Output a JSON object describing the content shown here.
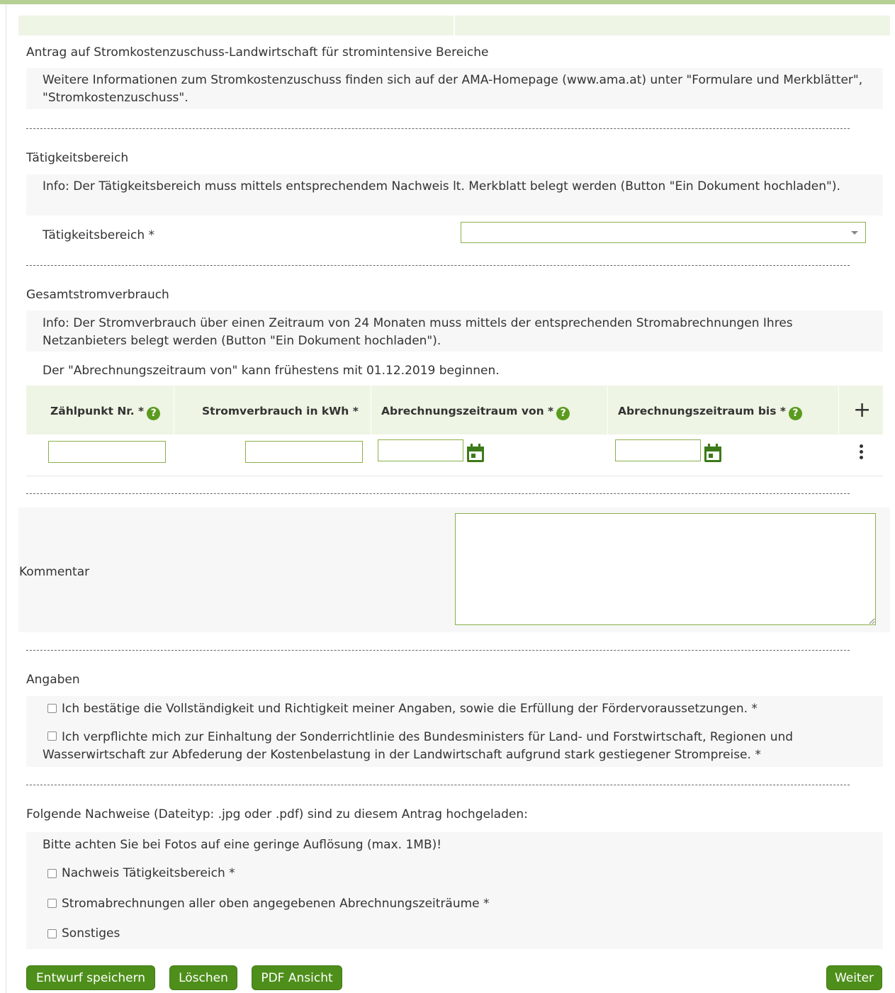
{
  "form_title": "Antrag auf Stromkostenzuschuss-Landwirtschaft für stromintensive Bereiche",
  "intro_info": "Weitere Informationen zum Stromkostenzuschuss finden sich auf der AMA-Homepage (www.ama.at) unter \"Formulare und Merkblätter\", \"Stromkostenzuschuss\".",
  "taetigkeit": {
    "heading": "Tätigkeitsbereich",
    "info": "Info: Der Tätigkeitsbereich muss mittels entsprechendem Nachweis lt. Merkblatt belegt werden (Button \"Ein Dokument hochladen\").",
    "field_label": "Tätigkeitsbereich *",
    "selected_value": ""
  },
  "gesamtstrom": {
    "heading": "Gesamtstromverbrauch",
    "info": "Info: Der Stromverbrauch über einen Zeitraum von 24 Monaten muss mittels der entsprechenden Stromabrechnungen Ihres Netzanbieters belegt werden (Button \"Ein Dokument hochladen\").",
    "date_note": "Der \"Abrechnungszeitraum von\" kann frühestens mit 01.12.2019 beginnen.",
    "columns": [
      "Zählpunkt Nr. *",
      "Stromverbrauch in kWh *",
      "Abrechnungszeitraum von *",
      "Abrechnungszeitraum bis *"
    ],
    "help_glyph": "?",
    "add_glyph": "+",
    "row": {
      "zaehlpunkt": "",
      "stromverbrauch": "",
      "von": "",
      "bis": ""
    }
  },
  "kommentar": {
    "label": "Kommentar",
    "value": ""
  },
  "angaben": {
    "heading": "Angaben",
    "confirm1": "Ich bestätige die Vollständigkeit und Richtigkeit meiner Angaben, sowie die Erfüllung der Fördervoraussetzungen. *",
    "confirm2": "Ich verpflichte mich zur Einhaltung der Sonderrichtlinie des Bundesministers für Land- und Forstwirtschaft, Regionen und Wasserwirtschaft zur Abfederung der Kostenbelastung in der Landwirtschaft aufgrund stark gestiegener Strompreise. *"
  },
  "nachweise": {
    "heading": "Folgende Nachweise (Dateityp: .jpg oder .pdf) sind zu diesem Antrag hochgeladen:",
    "note": "Bitte achten Sie bei Fotos auf eine geringe Auflösung (max. 1MB)!",
    "items": [
      "Nachweis Tätigkeitsbereich *",
      "Stromabrechnungen aller oben angegebenen Abrechnungszeiträume *",
      "Sonstiges"
    ]
  },
  "buttons": {
    "save_draft": "Entwurf speichern",
    "delete": "Löschen",
    "pdf_view": "PDF Ansicht",
    "next": "Weiter"
  },
  "colors": {
    "accent": "#4e8f1b",
    "input_border": "#8ab04a",
    "header_bg": "#eef5e4"
  }
}
